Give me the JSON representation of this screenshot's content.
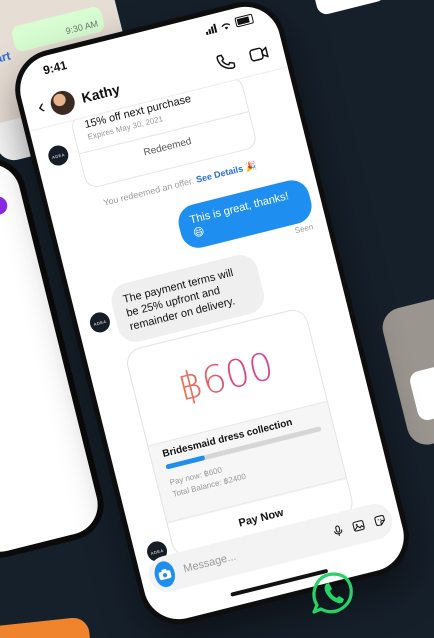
{
  "status_bar": {
    "time": "9:41"
  },
  "header": {
    "contact_name": "Kathy"
  },
  "brand_label": "ADEA",
  "offer": {
    "title": "15% off next purchase",
    "expires": "Expires May 30, 2021",
    "status": "Redeemed"
  },
  "system_note": {
    "text": "You redeemed an offer.",
    "link": "See Details",
    "emoji": "🎉"
  },
  "messages": {
    "outgoing": "This is great, thanks! 😄",
    "seen": "Seen",
    "incoming": "The payment terms will be 25% upfront and remainder on delivery."
  },
  "payment": {
    "amount": "฿600",
    "title": "Bridesmaid dress collection",
    "progress": 0.25,
    "pay_now": "Pay now: ฿600",
    "total_balance": "Total Balance: ฿2400",
    "button": "Pay Now"
  },
  "composer": {
    "placeholder": "Message..."
  },
  "background": {
    "whatsapp_time": "9:30 AM",
    "whatsapp_link": "art"
  },
  "colors": {
    "accent_blue": "#1e8ff0",
    "background": "#16202b",
    "whatsapp_green": "#25d366"
  }
}
